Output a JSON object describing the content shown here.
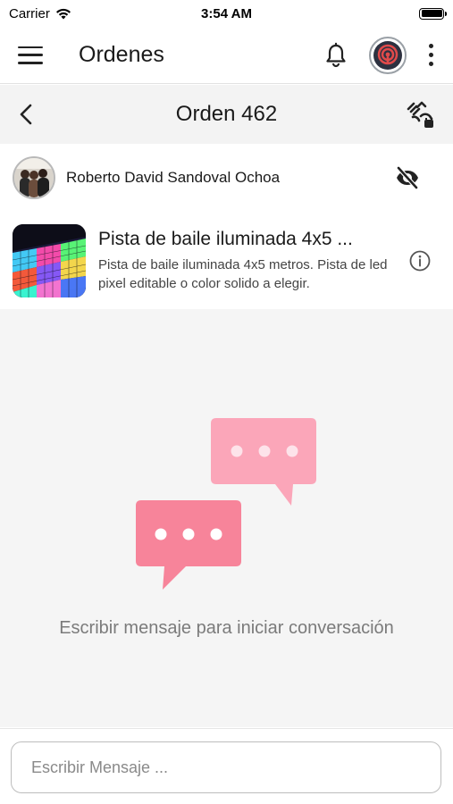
{
  "status_bar": {
    "carrier": "Carrier",
    "time": "3:54 AM"
  },
  "app_bar": {
    "title": "Ordenes"
  },
  "order": {
    "title": "Orden 462"
  },
  "customer": {
    "name": "Roberto David Sandoval Ochoa"
  },
  "product": {
    "title": "Pista de baile iluminada 4x5 ...",
    "description": "Pista de baile iluminada 4x5 metros. Pista de led pixel editable o color solido a elegir."
  },
  "chat": {
    "empty_message": "Escribir mensaje para iniciar conversación"
  },
  "composer": {
    "placeholder": "Escribir Mensaje ..."
  },
  "colors": {
    "bubble_front": "#f7849a",
    "bubble_back": "#fba6b9",
    "chat_bg": "#f5f5f5",
    "header_bg": "#f3f3f3",
    "status_accent": "#d84b4b"
  },
  "icons": {
    "menu": "hamburger-icon",
    "bell": "bell-icon",
    "more": "kebab-icon",
    "back": "chevron-left-icon",
    "scan": "scan-hand-icon",
    "hide": "eye-off-icon",
    "info": "info-icon",
    "wifi": "wifi-icon",
    "battery": "battery-icon"
  }
}
